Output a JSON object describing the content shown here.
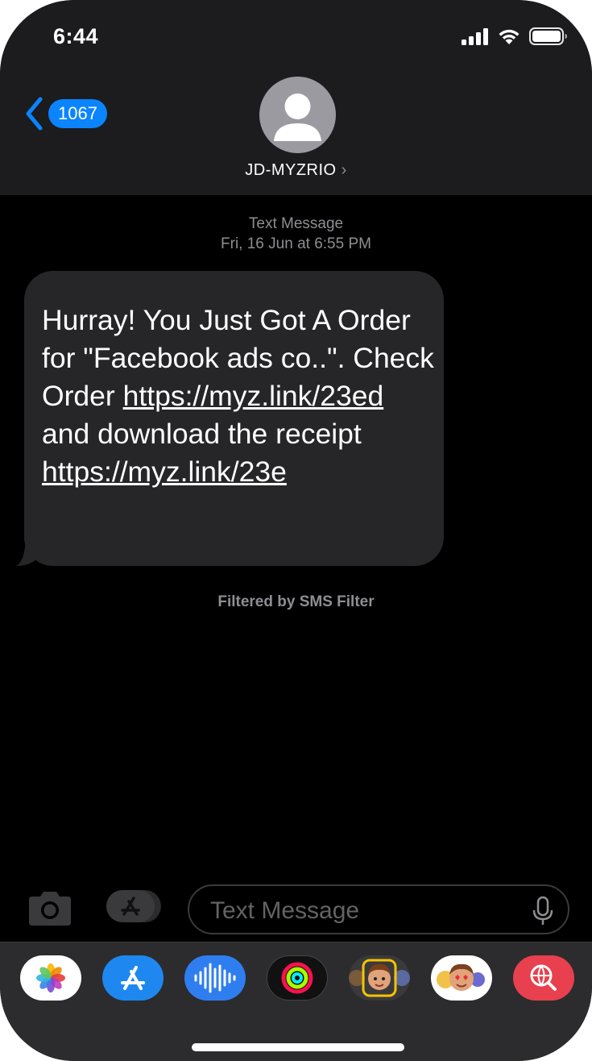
{
  "status": {
    "time": "6:44"
  },
  "nav": {
    "back_count": "1067",
    "contact_name": "JD-MYZRIO"
  },
  "conversation": {
    "type_label": "Text Message",
    "timestamp": "Fri, 16 Jun at 6:55 PM",
    "message": {
      "part1": "Hurray! You Just Got A Order for \"Facebook ads co..\". Check Order ",
      "link1": "https://myz.link/23ed",
      "part2": " and download the receipt ",
      "link2": "https://myz.link/23e"
    },
    "filter_note": "Filtered by SMS Filter"
  },
  "composer": {
    "placeholder": "Text Message"
  },
  "colors": {
    "accent": "#0a84ff",
    "bubble": "#262628",
    "header": "#1c1c1e"
  },
  "app_tray": [
    {
      "icon": "photos-app-icon"
    },
    {
      "icon": "app-store-icon"
    },
    {
      "icon": "audio-message-icon"
    },
    {
      "icon": "activity-icon"
    },
    {
      "icon": "memoji-icon"
    },
    {
      "icon": "memoji-stickers-icon"
    },
    {
      "icon": "search-images-icon"
    }
  ]
}
